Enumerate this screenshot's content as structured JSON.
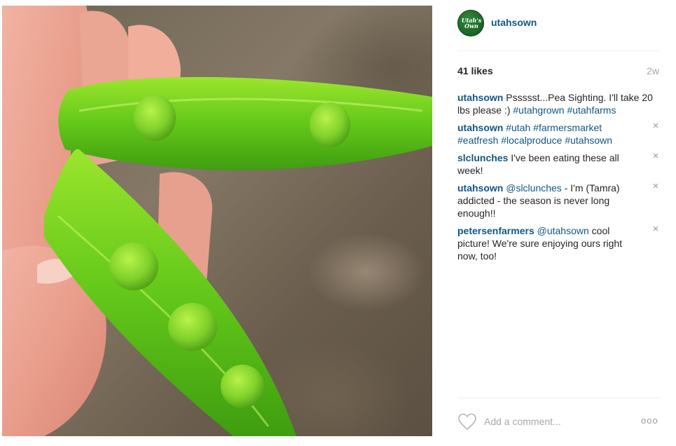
{
  "post": {
    "photo_alt": "Hand holding open pea pods",
    "author": {
      "username": "utahsown",
      "avatar_text": "Utah's Own"
    },
    "likes_label": "41 likes",
    "age": "2w",
    "caption": {
      "user": "utahsown",
      "text": " Pssssst...Pea Sighting. I'll take 20 lbs please :) ",
      "tag1": "#utahgrown",
      "tag2": "#utahfarms"
    },
    "comments": [
      {
        "user": "utahsown",
        "parts": [
          " ",
          "#utah",
          " ",
          "#farmersmarket",
          " ",
          "#eatfresh",
          " ",
          "#localproduce",
          " ",
          "#utahsown"
        ],
        "delete_icon": "×"
      },
      {
        "user": "slclunches",
        "text": " I've been eating these all week!",
        "delete_icon": "×"
      },
      {
        "user": "utahsown",
        "mention": "@slclunches",
        "text": " - I'm (Tamra) addicted - the season is never long enough!!",
        "delete_icon": "×"
      },
      {
        "user": "petersenfarmers",
        "mention": "@utahsown",
        "text": " cool picture! We're sure enjoying ours right now, too!",
        "delete_icon": "×"
      }
    ],
    "actions": {
      "like_icon": "heart-icon",
      "comment_placeholder": "Add a comment...",
      "more_label": "ooo"
    }
  }
}
